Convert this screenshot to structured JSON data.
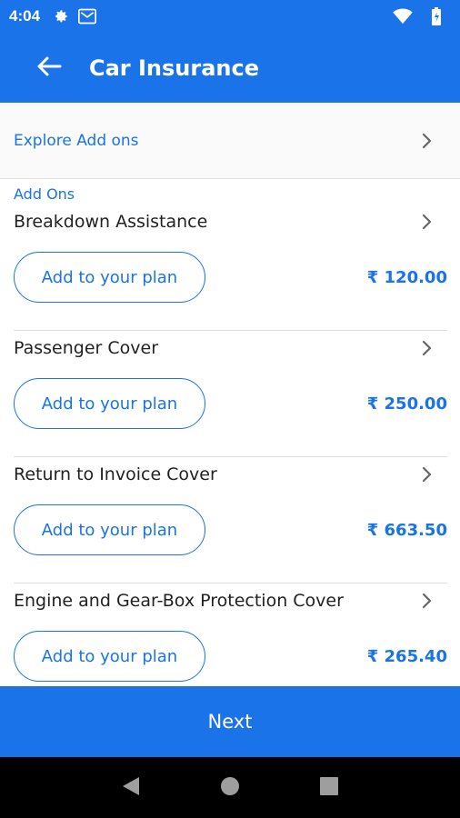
{
  "status_bar": {
    "time": "4:04"
  },
  "app_bar": {
    "title": "Car Insurance"
  },
  "explore": {
    "label": "Explore Add ons"
  },
  "section": {
    "title": "Add Ons"
  },
  "addons": [
    {
      "name": "Breakdown Assistance",
      "button": "Add to your plan",
      "price": "₹ 120.00"
    },
    {
      "name": "Passenger Cover",
      "button": "Add to your plan",
      "price": "₹ 250.00"
    },
    {
      "name": "Return to Invoice Cover",
      "button": "Add to your plan",
      "price": "₹ 663.50"
    },
    {
      "name": "Engine and Gear-Box Protection Cover",
      "button": "Add to your plan",
      "price": "₹ 265.40"
    }
  ],
  "footer": {
    "next_label": "Next"
  },
  "colors": {
    "primary": "#1a73e8",
    "nav_bar": "#000000",
    "text": "#222222"
  },
  "icons": [
    "settings-icon",
    "gmail-icon",
    "wifi-icon",
    "battery-icon",
    "back-arrow-icon",
    "chevron-right-icon",
    "nav-back-icon",
    "nav-home-icon",
    "nav-recents-icon"
  ]
}
